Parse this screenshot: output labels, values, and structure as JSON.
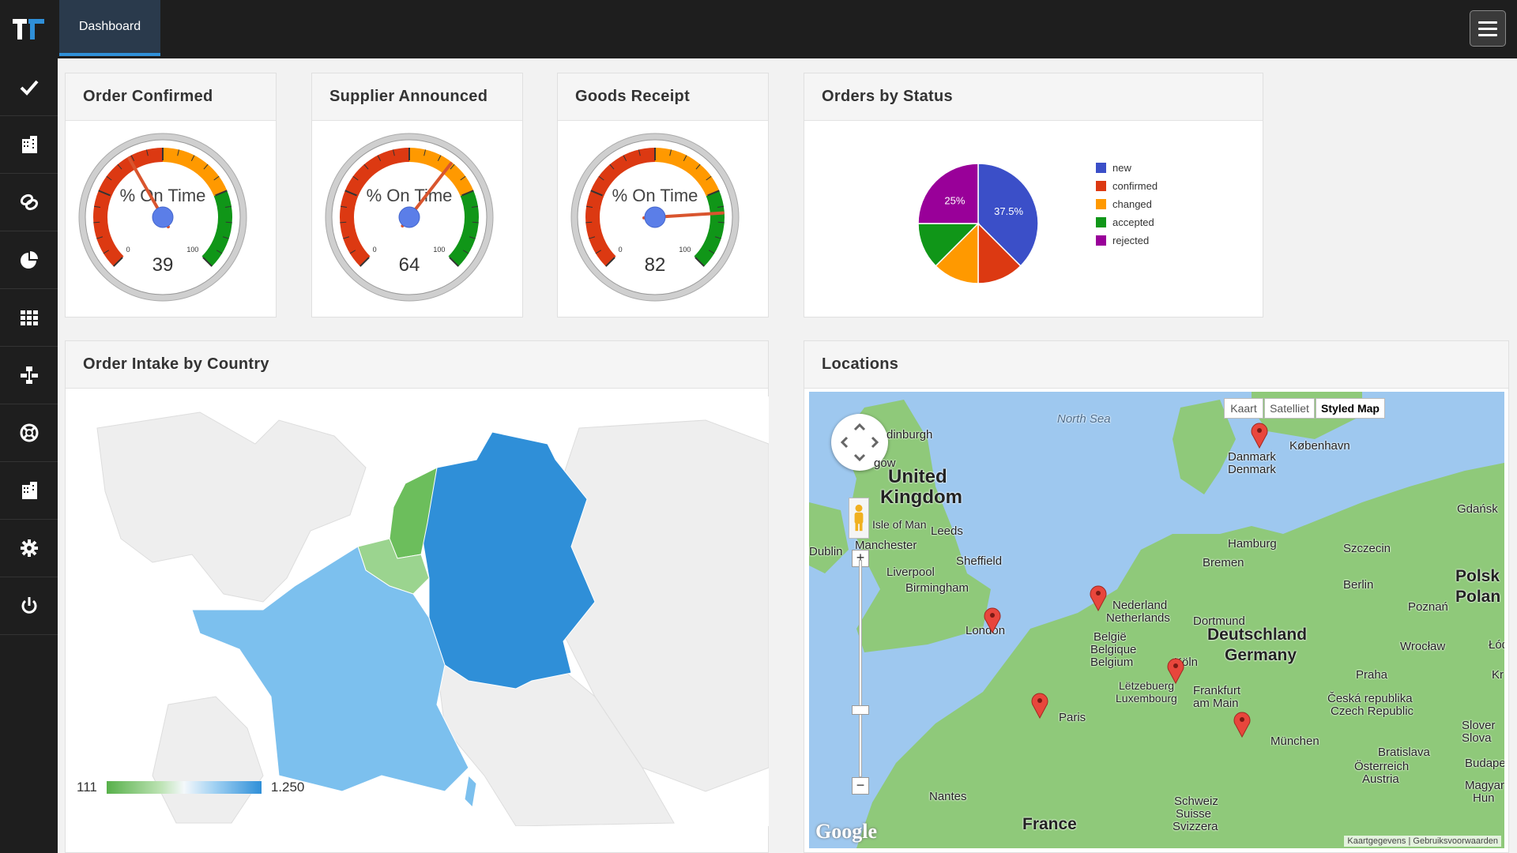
{
  "header": {
    "tab_label": "Dashboard"
  },
  "sidebar": {
    "icons": [
      "check-icon",
      "building-icon",
      "link-icon",
      "pie-chart-icon",
      "grid-icon",
      "sitemap-icon",
      "life-ring-icon",
      "building-icon-2",
      "gear-icon",
      "power-icon"
    ]
  },
  "gauges": [
    {
      "title": "Order Confirmed",
      "label": "% On Time",
      "value": 39,
      "min_label": "0",
      "max_label": "100"
    },
    {
      "title": "Supplier Announced",
      "label": "% On Time",
      "value": 64,
      "min_label": "0",
      "max_label": "100"
    },
    {
      "title": "Goods Receipt",
      "label": "% On Time",
      "value": 82,
      "min_label": "0",
      "max_label": "100"
    }
  ],
  "status_panel": {
    "title": "Orders by Status",
    "legend": [
      {
        "label": "new",
        "color": "#3b4fc8"
      },
      {
        "label": "confirmed",
        "color": "#dc3912"
      },
      {
        "label": "changed",
        "color": "#ff9900"
      },
      {
        "label": "accepted",
        "color": "#109618"
      },
      {
        "label": "rejected",
        "color": "#990099"
      }
    ]
  },
  "chart_data": {
    "type": "pie",
    "slices": [
      {
        "label": "new",
        "value": 37.5,
        "data_label": "37.5%",
        "color": "#3b4fc8"
      },
      {
        "label": "confirmed",
        "value": 12.5,
        "data_label": "",
        "color": "#dc3912"
      },
      {
        "label": "changed",
        "value": 12.5,
        "data_label": "",
        "color": "#ff9900"
      },
      {
        "label": "accepted",
        "value": 12.5,
        "data_label": "",
        "color": "#109618"
      },
      {
        "label": "rejected",
        "value": 25,
        "data_label": "25%",
        "color": "#990099"
      }
    ],
    "legend": "right"
  },
  "country_panel": {
    "title": "Order Intake by Country",
    "scale_min": "111",
    "scale_max": "1.250"
  },
  "locations_panel": {
    "title": "Locations",
    "map_types": [
      "Kaart",
      "Satelliet",
      "Styled Map"
    ],
    "active_map_type": "Styled Map",
    "labels": {
      "north_sea": "North Sea",
      "edinburgh": "dinburgh",
      "glasgow": "gow",
      "uk_1": "United",
      "uk_2": "Kingdom",
      "isle_of_man": "Isle of Man",
      "leeds": "Leeds",
      "dublin": "Dublin",
      "manchester": "Manchester",
      "sheffield": "Sheffield",
      "liverpool": "Liverpool",
      "birmingham": "Birmingham",
      "london": "London",
      "copenhagen": "København",
      "danmark": "Danmark",
      "denmark": "Denmark",
      "gdansk": "Gdańsk",
      "hamburg": "Hamburg",
      "szczecin": "Szczecin",
      "bremen": "Bremen",
      "berlin": "Berlin",
      "polska": "Polsk",
      "poland": "Polan",
      "nederland": "Nederland",
      "netherlands": "Netherlands",
      "poznan": "Poznań",
      "dortmund": "Dortmund",
      "deutschland": "Deutschland",
      "germany": "Germany",
      "belgie": "België",
      "belgique": "Belgique",
      "belgium": "Belgium",
      "koln": "Köln",
      "wroclaw": "Wrocław",
      "letzebuerg": "Lëtzebuerg",
      "luxembourg": "Luxembourg",
      "frankfurt_1": "Frankfurt",
      "frankfurt_2": "am Main",
      "praha": "Praha",
      "ceska": "Česká republika",
      "czech": "Czech Republic",
      "paris": "Paris",
      "munchen": "München",
      "slovakia_1": "Slover",
      "slovakia_2": "Slova",
      "bratislava": "Bratislava",
      "osterreich": "Österreich",
      "austria": "Austria",
      "budapest": "Budape",
      "magyar": "Magyar",
      "hungary": "Hun",
      "nantes": "Nantes",
      "schweiz": "Schweiz",
      "suisse": "Suisse",
      "svizzera": "Svizzera",
      "france": "France",
      "lodz": "Łód",
      "kr": "Kr"
    },
    "google": "Google",
    "attribution": "Kaartgegevens | Gebruiksvoorwaarden"
  },
  "colors": {
    "gauge_red": "#dc3912",
    "gauge_orange": "#ff9900",
    "gauge_green": "#109618",
    "choropleth_low": "#57b04a",
    "choropleth_high": "#2f8fd8"
  }
}
